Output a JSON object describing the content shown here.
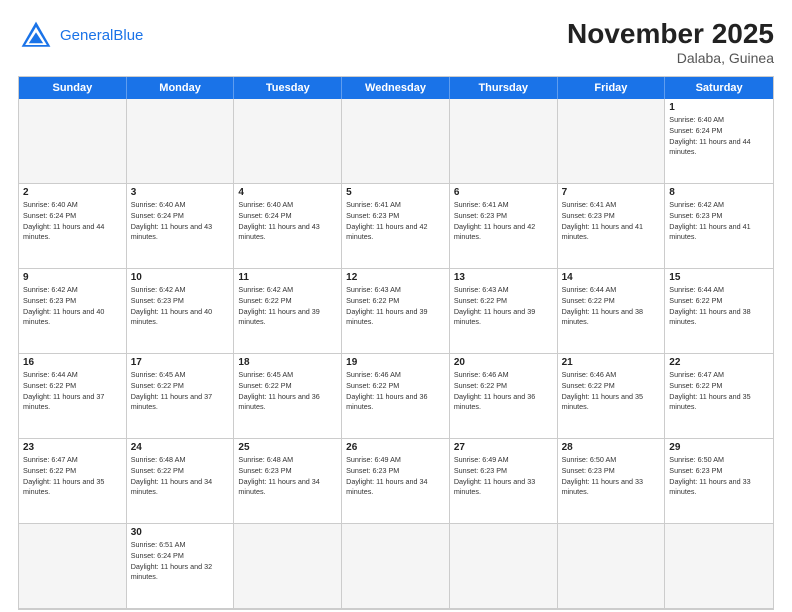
{
  "header": {
    "logo_general": "General",
    "logo_blue": "Blue",
    "month_title": "November 2025",
    "subtitle": "Dalaba, Guinea"
  },
  "days": [
    "Sunday",
    "Monday",
    "Tuesday",
    "Wednesday",
    "Thursday",
    "Friday",
    "Saturday"
  ],
  "cells": [
    {
      "day": null,
      "empty": true
    },
    {
      "day": null,
      "empty": true
    },
    {
      "day": null,
      "empty": true
    },
    {
      "day": null,
      "empty": true
    },
    {
      "day": null,
      "empty": true
    },
    {
      "day": null,
      "empty": true
    },
    {
      "day": "1",
      "sunrise": "6:40 AM",
      "sunset": "6:24 PM",
      "daylight": "11 hours and 44 minutes."
    },
    {
      "day": "2",
      "sunrise": "6:40 AM",
      "sunset": "6:24 PM",
      "daylight": "11 hours and 44 minutes."
    },
    {
      "day": "3",
      "sunrise": "6:40 AM",
      "sunset": "6:24 PM",
      "daylight": "11 hours and 43 minutes."
    },
    {
      "day": "4",
      "sunrise": "6:40 AM",
      "sunset": "6:24 PM",
      "daylight": "11 hours and 43 minutes."
    },
    {
      "day": "5",
      "sunrise": "6:41 AM",
      "sunset": "6:23 PM",
      "daylight": "11 hours and 42 minutes."
    },
    {
      "day": "6",
      "sunrise": "6:41 AM",
      "sunset": "6:23 PM",
      "daylight": "11 hours and 42 minutes."
    },
    {
      "day": "7",
      "sunrise": "6:41 AM",
      "sunset": "6:23 PM",
      "daylight": "11 hours and 41 minutes."
    },
    {
      "day": "8",
      "sunrise": "6:42 AM",
      "sunset": "6:23 PM",
      "daylight": "11 hours and 41 minutes."
    },
    {
      "day": "9",
      "sunrise": "6:42 AM",
      "sunset": "6:23 PM",
      "daylight": "11 hours and 40 minutes."
    },
    {
      "day": "10",
      "sunrise": "6:42 AM",
      "sunset": "6:23 PM",
      "daylight": "11 hours and 40 minutes."
    },
    {
      "day": "11",
      "sunrise": "6:42 AM",
      "sunset": "6:22 PM",
      "daylight": "11 hours and 39 minutes."
    },
    {
      "day": "12",
      "sunrise": "6:43 AM",
      "sunset": "6:22 PM",
      "daylight": "11 hours and 39 minutes."
    },
    {
      "day": "13",
      "sunrise": "6:43 AM",
      "sunset": "6:22 PM",
      "daylight": "11 hours and 39 minutes."
    },
    {
      "day": "14",
      "sunrise": "6:44 AM",
      "sunset": "6:22 PM",
      "daylight": "11 hours and 38 minutes."
    },
    {
      "day": "15",
      "sunrise": "6:44 AM",
      "sunset": "6:22 PM",
      "daylight": "11 hours and 38 minutes."
    },
    {
      "day": "16",
      "sunrise": "6:44 AM",
      "sunset": "6:22 PM",
      "daylight": "11 hours and 37 minutes."
    },
    {
      "day": "17",
      "sunrise": "6:45 AM",
      "sunset": "6:22 PM",
      "daylight": "11 hours and 37 minutes."
    },
    {
      "day": "18",
      "sunrise": "6:45 AM",
      "sunset": "6:22 PM",
      "daylight": "11 hours and 36 minutes."
    },
    {
      "day": "19",
      "sunrise": "6:46 AM",
      "sunset": "6:22 PM",
      "daylight": "11 hours and 36 minutes."
    },
    {
      "day": "20",
      "sunrise": "6:46 AM",
      "sunset": "6:22 PM",
      "daylight": "11 hours and 36 minutes."
    },
    {
      "day": "21",
      "sunrise": "6:46 AM",
      "sunset": "6:22 PM",
      "daylight": "11 hours and 35 minutes."
    },
    {
      "day": "22",
      "sunrise": "6:47 AM",
      "sunset": "6:22 PM",
      "daylight": "11 hours and 35 minutes."
    },
    {
      "day": "23",
      "sunrise": "6:47 AM",
      "sunset": "6:22 PM",
      "daylight": "11 hours and 35 minutes."
    },
    {
      "day": "24",
      "sunrise": "6:48 AM",
      "sunset": "6:22 PM",
      "daylight": "11 hours and 34 minutes."
    },
    {
      "day": "25",
      "sunrise": "6:48 AM",
      "sunset": "6:23 PM",
      "daylight": "11 hours and 34 minutes."
    },
    {
      "day": "26",
      "sunrise": "6:49 AM",
      "sunset": "6:23 PM",
      "daylight": "11 hours and 34 minutes."
    },
    {
      "day": "27",
      "sunrise": "6:49 AM",
      "sunset": "6:23 PM",
      "daylight": "11 hours and 33 minutes."
    },
    {
      "day": "28",
      "sunrise": "6:50 AM",
      "sunset": "6:23 PM",
      "daylight": "11 hours and 33 minutes."
    },
    {
      "day": "29",
      "sunrise": "6:50 AM",
      "sunset": "6:23 PM",
      "daylight": "11 hours and 33 minutes."
    },
    {
      "day": null,
      "empty": true
    },
    {
      "day": "30",
      "sunrise": "6:51 AM",
      "sunset": "6:24 PM",
      "daylight": "11 hours and 32 minutes."
    },
    {
      "day": null,
      "empty": true
    },
    {
      "day": null,
      "empty": true
    },
    {
      "day": null,
      "empty": true
    },
    {
      "day": null,
      "empty": true
    },
    {
      "day": null,
      "empty": true
    }
  ]
}
